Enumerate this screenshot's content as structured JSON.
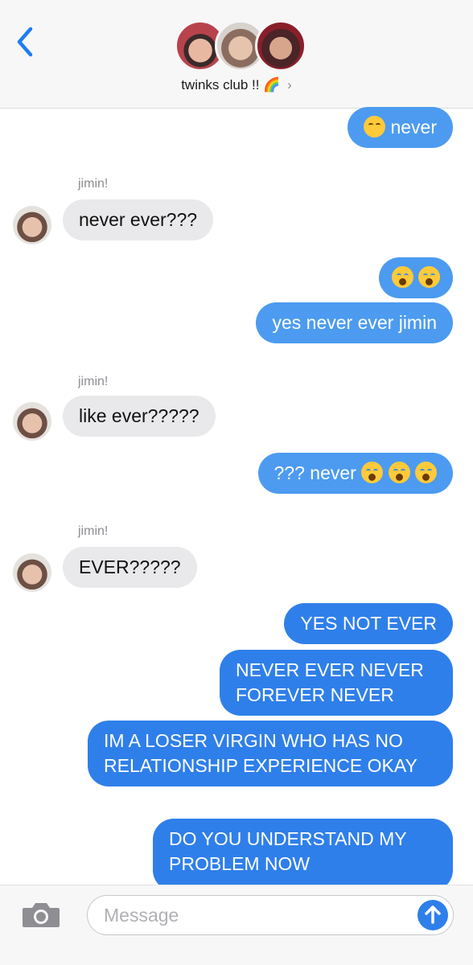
{
  "header": {
    "group_name": "twinks club !! 🌈",
    "chevron": "›"
  },
  "sender_name": "jimin!",
  "messages": [
    {
      "text": "never",
      "emoji": [
        "disappointed-face"
      ]
    },
    {
      "text": "never ever???"
    },
    {
      "emoji": [
        "loudly-crying-face",
        "loudly-crying-face"
      ]
    },
    {
      "text": "yes never ever jimin"
    },
    {
      "text": "like ever?????"
    },
    {
      "text": "??? never",
      "emoji": [
        "loudly-crying-face",
        "loudly-crying-face",
        "loudly-crying-face"
      ]
    },
    {
      "text": "EVER?????"
    },
    {
      "text": "YES NOT EVER"
    },
    {
      "text": "NEVER EVER NEVER FOREVER NEVER"
    },
    {
      "text": "IM A LOSER VIRGIN WHO HAS NO RELATIONSHIP EXPERIENCE OKAY"
    },
    {
      "text": "DO YOU UNDERSTAND MY PROBLEM NOW"
    }
  ],
  "input": {
    "placeholder": "Message"
  },
  "colors": {
    "outgoing_light": "#4c9bf0",
    "outgoing_dark": "#2f7fea",
    "incoming": "#e9e9eb",
    "ios_blue": "#1f7cf4"
  },
  "icons": [
    "chevron-left-icon",
    "camera-icon",
    "send-arrow-icon"
  ]
}
